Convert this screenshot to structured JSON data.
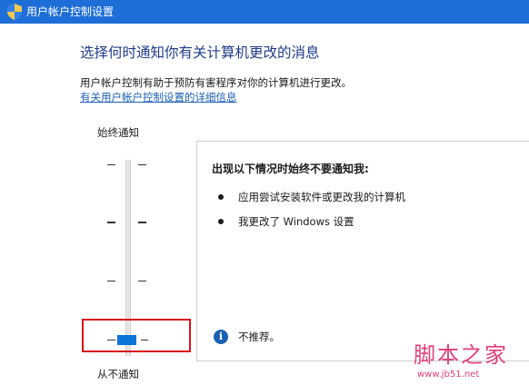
{
  "window": {
    "title": "用户帐户控制设置"
  },
  "main": {
    "heading": "选择何时通知你有关计算机更改的消息",
    "description": "用户帐户控制有助于预防有害程序对你的计算机进行更改。",
    "details_link": "有关用户帐户控制设置的详细信息"
  },
  "slider": {
    "top_label": "始终通知",
    "bottom_label": "从不通知",
    "levels": 4,
    "selected_level": 0,
    "selected_level_description": "lowest of 4 levels (never notify)"
  },
  "panel": {
    "title": "出现以下情况时始终不要通知我:",
    "bullets": [
      "应用尝试安装软件或更改我的计算机",
      "我更改了 Windows 设置"
    ],
    "info_text": "不推荐。"
  },
  "watermark": {
    "brand": "脚本之家",
    "url": "www.jb51.net"
  },
  "colors": {
    "titlebar": "#1e6ed8",
    "heading": "#1e3a8a",
    "link": "#1a5fb4",
    "slider_thumb": "#0a74da",
    "highlight_border": "#d9141b",
    "watermark": "#e0407a"
  },
  "icons": {
    "title": "uac-shield-icon",
    "info": "info-icon"
  }
}
